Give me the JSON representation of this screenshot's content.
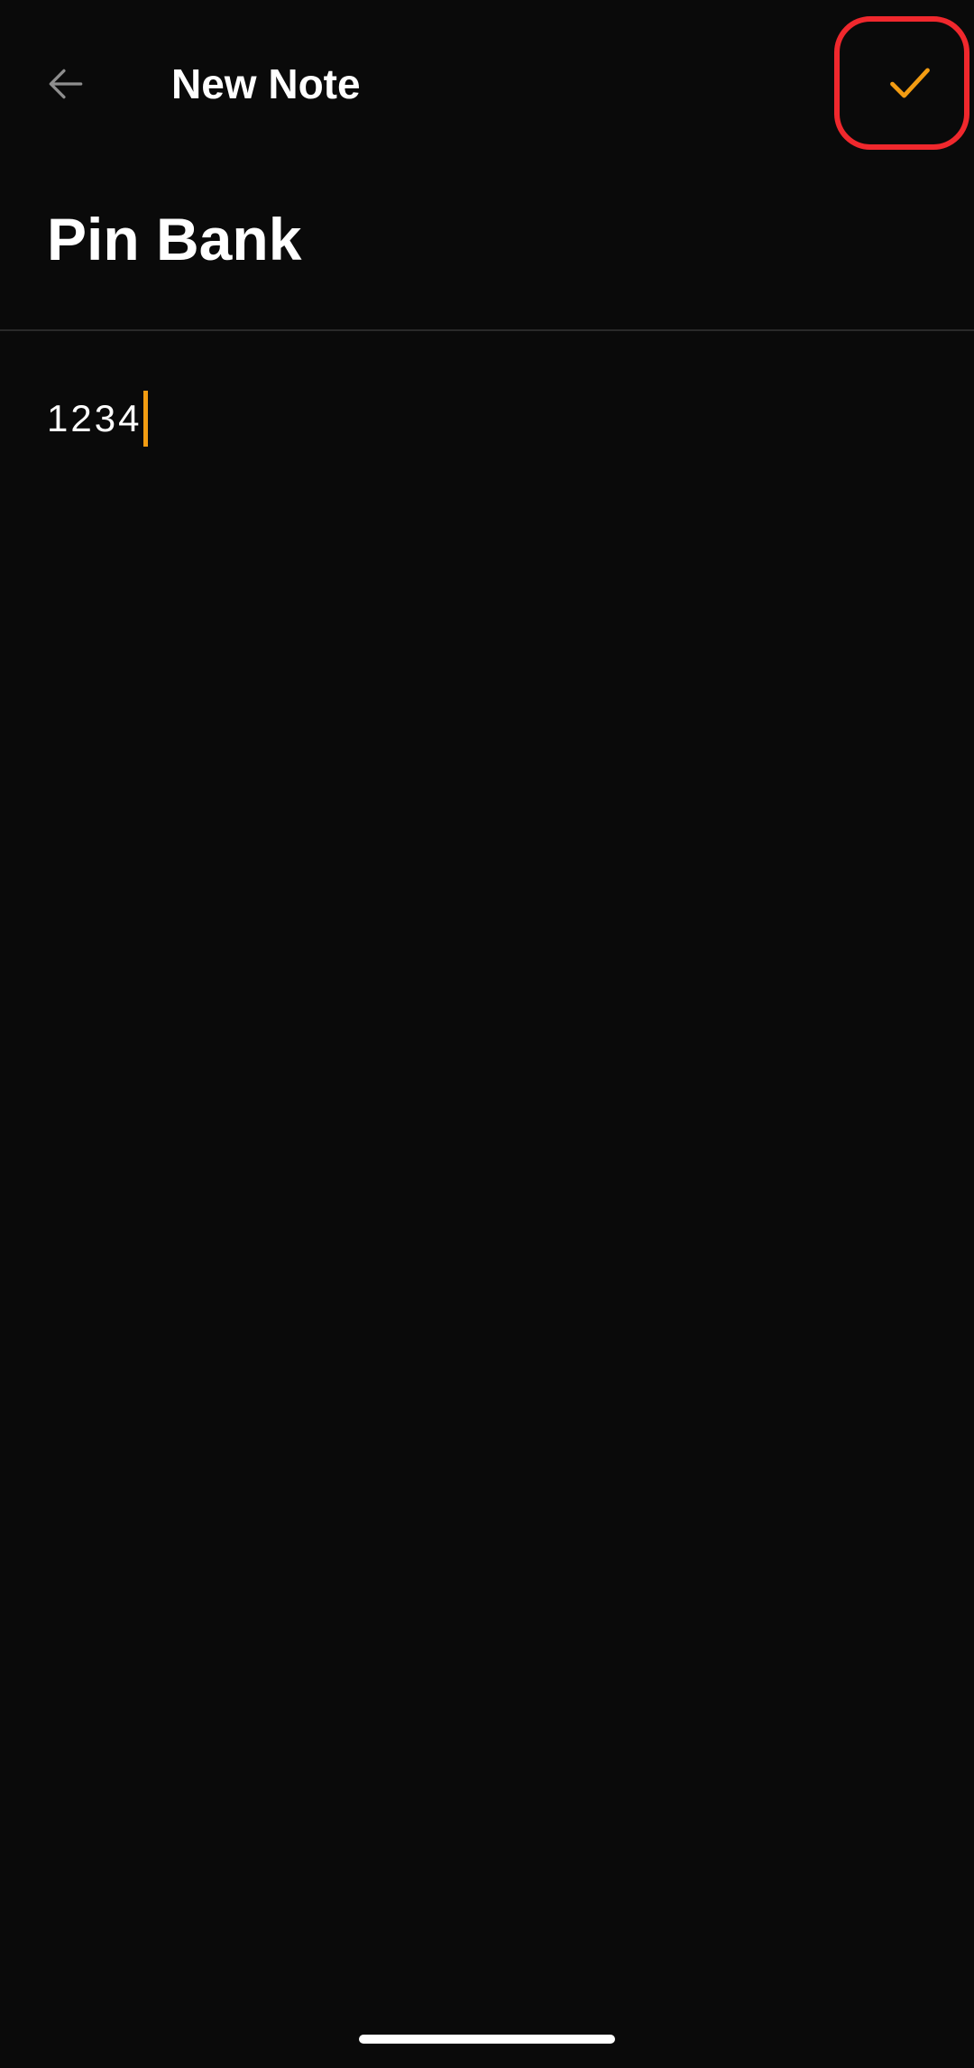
{
  "app_bar": {
    "back_icon": "arrow-left-icon",
    "title": "New Note",
    "save_icon": "check-icon"
  },
  "note": {
    "title": "Pin Bank",
    "body": "1234"
  },
  "colors": {
    "background": "#0a0a0a",
    "accent": "#f39c12",
    "highlight": "#f0282d",
    "icon_muted": "#8e8e8e",
    "divider": "#2a2a2a"
  }
}
